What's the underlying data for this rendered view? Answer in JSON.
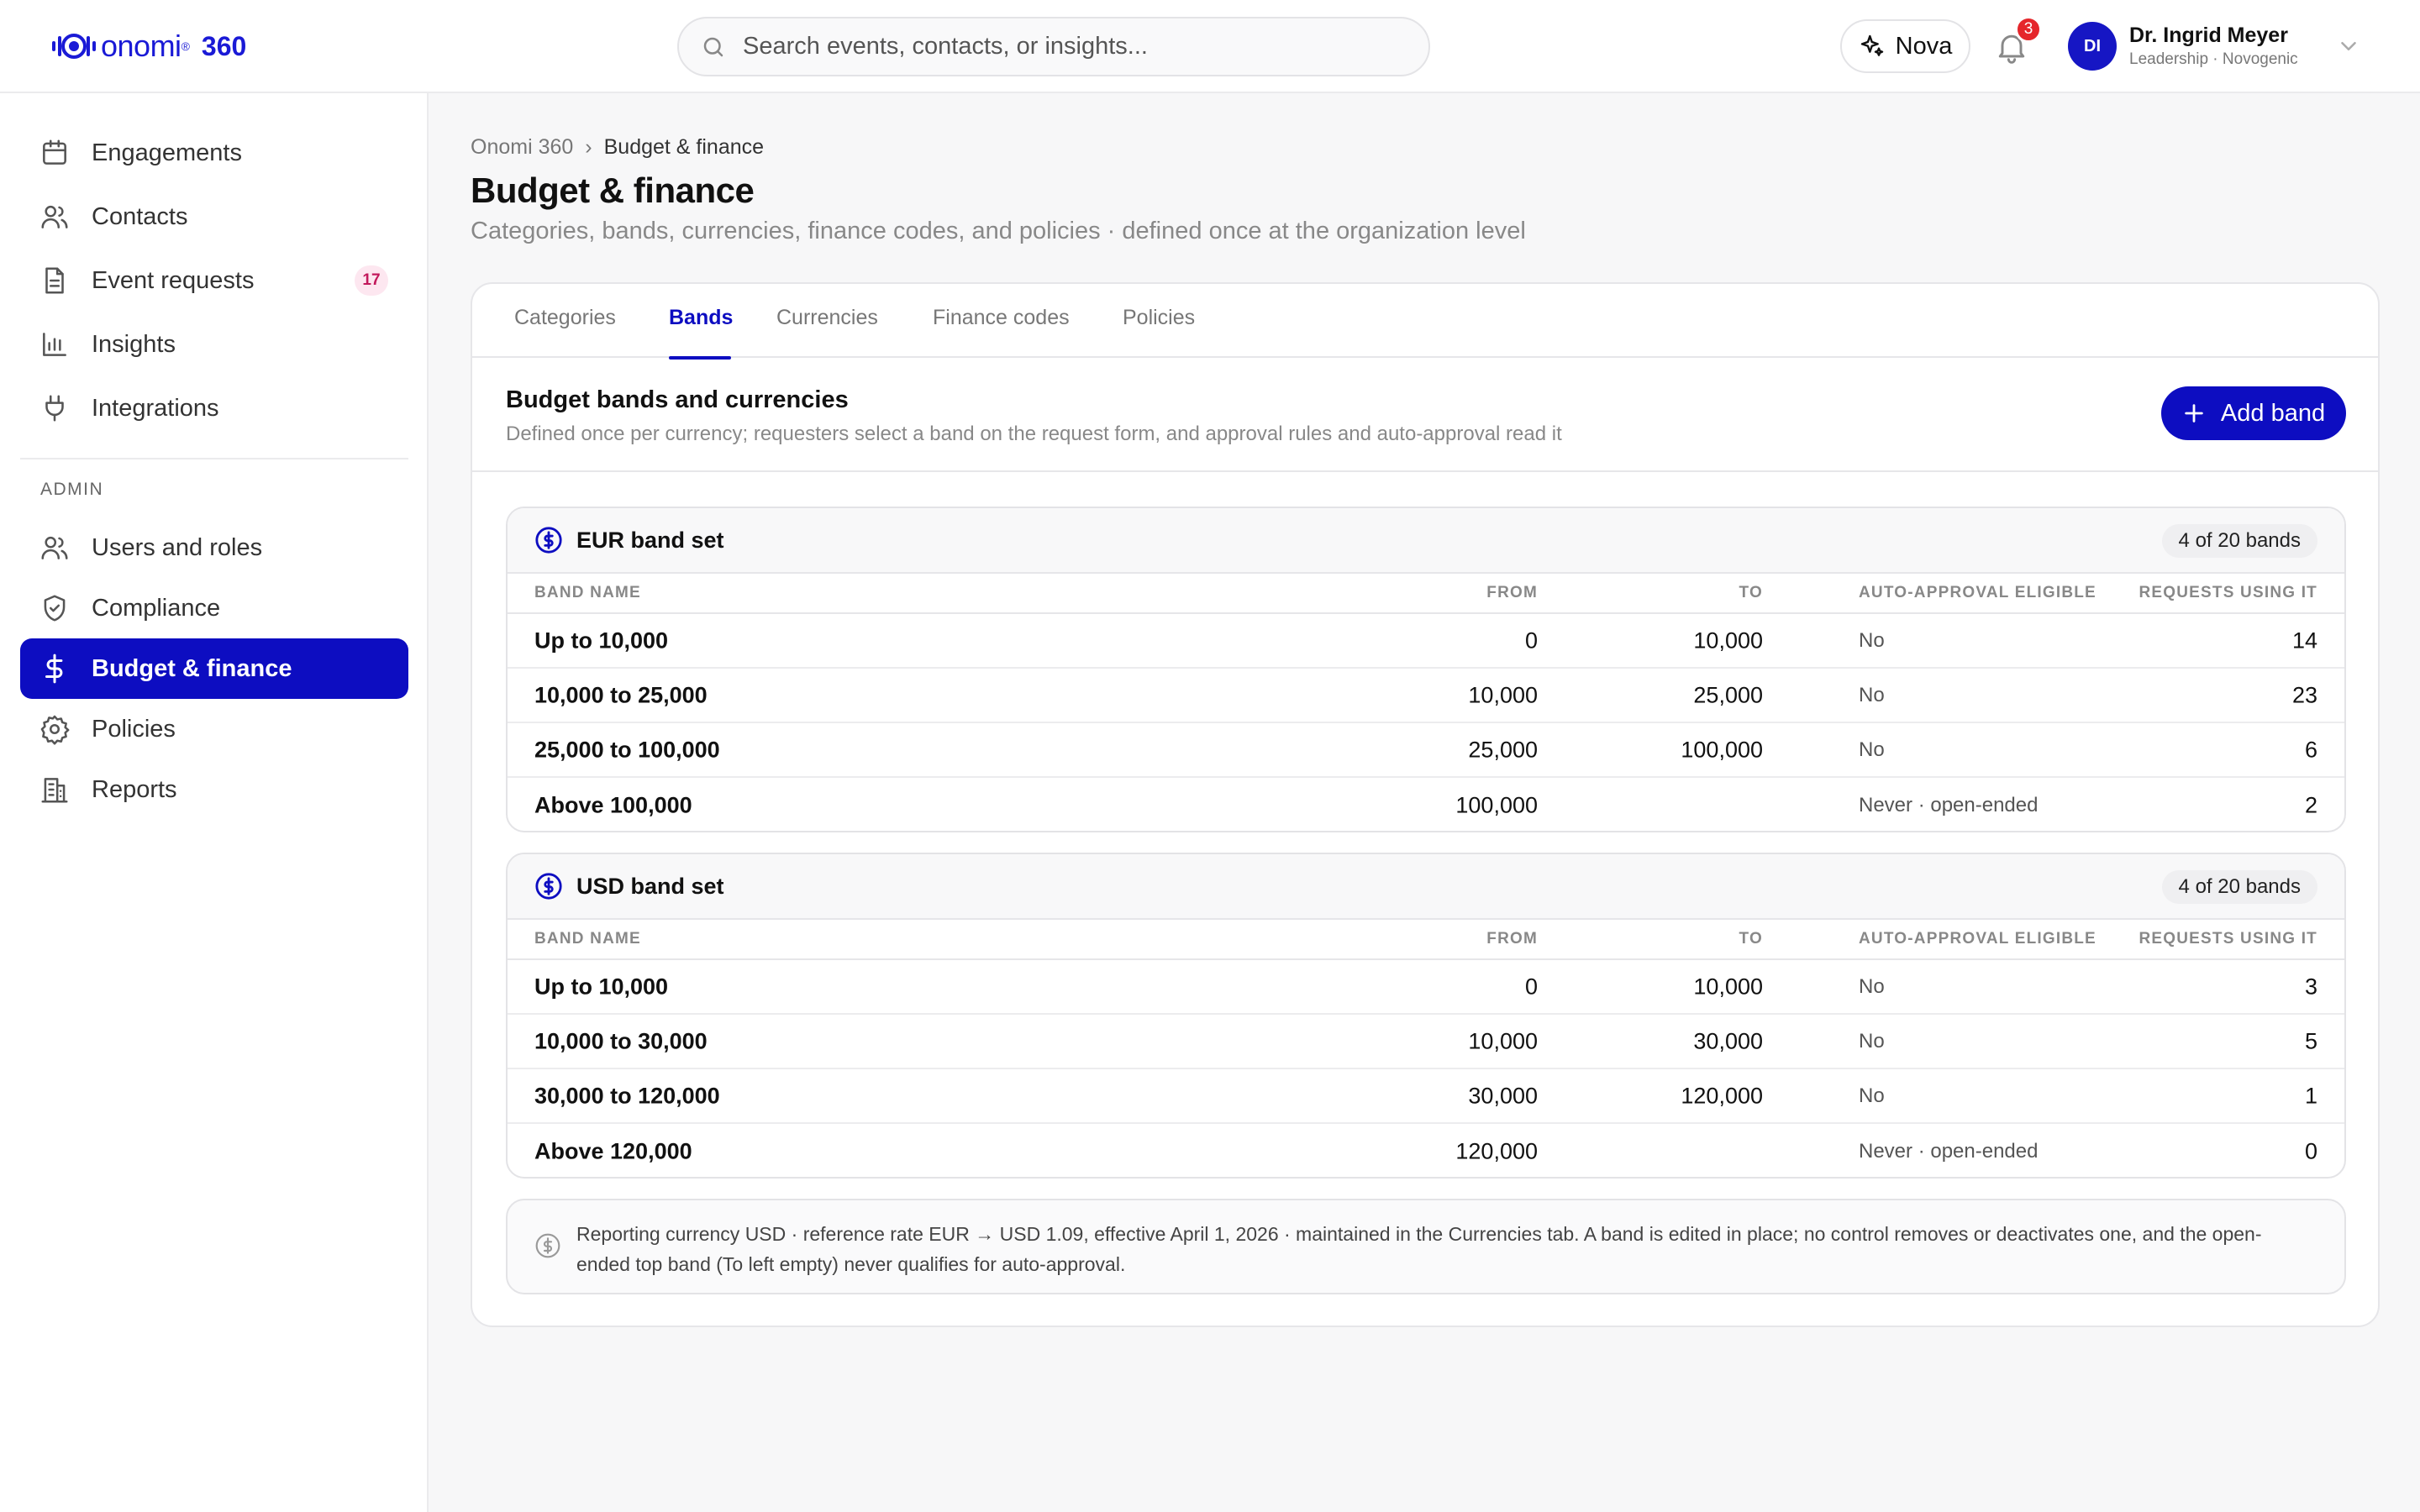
{
  "app": {
    "brand_word": "onomi",
    "brand_reg": "®",
    "brand_suffix": "360"
  },
  "search": {
    "placeholder": "Search events, contacts, or insights..."
  },
  "assistant": {
    "label": "Nova"
  },
  "notifications": {
    "count": "3"
  },
  "user": {
    "initials": "DI",
    "name": "Dr. Ingrid Meyer",
    "role": "Leadership · Novogenic"
  },
  "sidebar": {
    "items": [
      {
        "label": "Engagements",
        "icon": "calendar-icon"
      },
      {
        "label": "Contacts",
        "icon": "users-icon"
      },
      {
        "label": "Event requests",
        "icon": "document-icon",
        "badge": "17"
      },
      {
        "label": "Insights",
        "icon": "bar-chart-icon"
      },
      {
        "label": "Integrations",
        "icon": "plug-icon"
      }
    ],
    "admin_heading": "ADMIN",
    "admin_items": [
      {
        "label": "Users and roles",
        "icon": "users-icon"
      },
      {
        "label": "Compliance",
        "icon": "shield-icon"
      },
      {
        "label": "Budget & finance",
        "icon": "dollar-icon",
        "active": true
      },
      {
        "label": "Policies",
        "icon": "gear-icon"
      },
      {
        "label": "Reports",
        "icon": "building-icon"
      }
    ]
  },
  "breadcrumb": {
    "root": "Onomi 360",
    "separator": "›",
    "current": "Budget & finance"
  },
  "page": {
    "title": "Budget & finance",
    "subtitle": "Categories, bands, currencies, finance codes, and policies · defined once at the organization level"
  },
  "tabs": [
    {
      "label": "Categories"
    },
    {
      "label": "Bands",
      "active": true
    },
    {
      "label": "Currencies"
    },
    {
      "label": "Finance codes"
    },
    {
      "label": "Policies"
    }
  ],
  "section": {
    "title": "Budget bands and currencies",
    "description": "Defined once per currency; requesters select a band on the request form, and approval rules and auto-approval read it",
    "add_button": "Add band"
  },
  "table_headers": {
    "name": "BAND NAME",
    "from": "FROM",
    "to": "TO",
    "auto": "AUTO-APPROVAL ELIGIBLE",
    "requests": "REQUESTS USING IT"
  },
  "band_sets": [
    {
      "title": "EUR band set",
      "count": "4 of 20 bands",
      "rows": [
        {
          "name": "Up to 10,000",
          "from": "0",
          "to": "10,000",
          "auto": "No",
          "requests": "14"
        },
        {
          "name": "10,000 to 25,000",
          "from": "10,000",
          "to": "25,000",
          "auto": "No",
          "requests": "23"
        },
        {
          "name": "25,000 to 100,000",
          "from": "25,000",
          "to": "100,000",
          "auto": "No",
          "requests": "6"
        },
        {
          "name": "Above 100,000",
          "from": "100,000",
          "to": "",
          "auto": "Never · open-ended",
          "requests": "2"
        }
      ]
    },
    {
      "title": "USD band set",
      "count": "4 of 20 bands",
      "rows": [
        {
          "name": "Up to 10,000",
          "from": "0",
          "to": "10,000",
          "auto": "No",
          "requests": "3"
        },
        {
          "name": "10,000 to 30,000",
          "from": "10,000",
          "to": "30,000",
          "auto": "No",
          "requests": "5"
        },
        {
          "name": "30,000 to 120,000",
          "from": "30,000",
          "to": "120,000",
          "auto": "No",
          "requests": "1"
        },
        {
          "name": "Above 120,000",
          "from": "120,000",
          "to": "",
          "auto": "Never · open-ended",
          "requests": "0"
        }
      ]
    }
  ],
  "footnote": "Reporting currency USD · reference rate EUR → USD 1.09, effective April 1, 2026 · maintained in the Currencies tab. A band is edited in place; no control removes or deactivates one, and the open-ended top band (To left empty) never qualifies for auto-approval.",
  "colors": {
    "accent": "#0d0dc1",
    "brand": "#1a1ad6",
    "alert": "#e5262b"
  }
}
